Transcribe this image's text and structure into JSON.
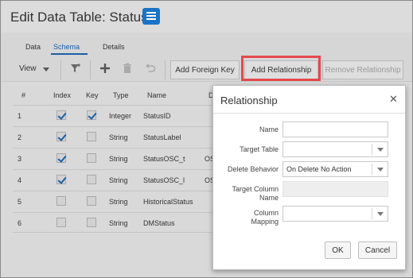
{
  "header": {
    "title": "Edit Data Table: Status",
    "icon": "table-icon"
  },
  "tabs": [
    {
      "label": "Data"
    },
    {
      "label": "Schema",
      "active": true
    },
    {
      "label": "Details"
    }
  ],
  "toolbar": {
    "view_label": "View",
    "add_foreign_key": "Add Foreign Key",
    "add_relationship": "Add Relationship",
    "remove_relationship": "Remove Relationship",
    "icons": [
      "filter-icon",
      "plus-icon",
      "trash-icon",
      "undo-icon"
    ]
  },
  "table": {
    "headers": [
      "#",
      "Index",
      "Key",
      "Type",
      "Name",
      "D"
    ],
    "rows": [
      {
        "num": "1",
        "index": true,
        "key": true,
        "type": "Integer",
        "name": "StatusID",
        "extra": ""
      },
      {
        "num": "2",
        "index": true,
        "key": false,
        "type": "String",
        "name": "StatusLabel",
        "extra": ""
      },
      {
        "num": "3",
        "index": true,
        "key": false,
        "type": "String",
        "name": "StatusOSC_t",
        "extra": "OS"
      },
      {
        "num": "4",
        "index": true,
        "key": false,
        "type": "String",
        "name": "StatusOSC_l",
        "extra": "OS"
      },
      {
        "num": "5",
        "index": false,
        "key": false,
        "type": "String",
        "name": "HistoricalStatus",
        "extra": ""
      },
      {
        "num": "6",
        "index": false,
        "key": false,
        "type": "String",
        "name": "DMStatus",
        "extra": ""
      }
    ]
  },
  "dialog": {
    "title": "Relationship",
    "close_icon": "close-icon",
    "fields": {
      "name_label": "Name",
      "name_value": "",
      "target_table_label": "Target Table",
      "target_table_value": "",
      "delete_behavior_label": "Delete Behavior",
      "delete_behavior_value": "On Delete No Action",
      "target_column_label_1": "Target Column",
      "target_column_label_2": "Name",
      "target_column_value": "",
      "column_mapping_label_1": "Column",
      "column_mapping_label_2": "Mapping",
      "column_mapping_value": ""
    },
    "ok_label": "OK",
    "cancel_label": "Cancel"
  },
  "colors": {
    "accent": "#1a5fa8",
    "highlight": "#e5484d",
    "icon_bg": "#1a73c7"
  }
}
